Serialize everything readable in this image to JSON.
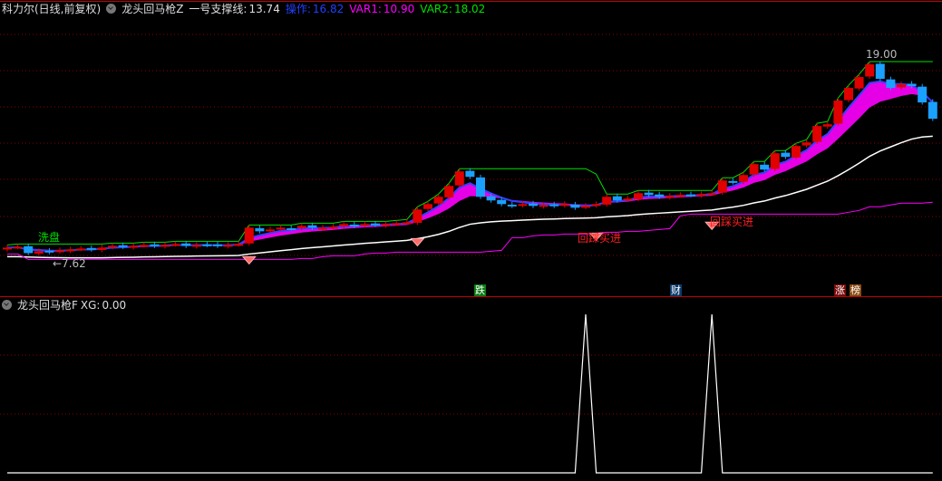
{
  "header": {
    "stock": "科力尔(日线,前复权)",
    "indicator": "龙头回马枪Z",
    "support_label": "一号支撑线:",
    "support_value": "13.74",
    "op_label": "操作:",
    "op_value": "16.82",
    "var1_label": "VAR1:",
    "var1_value": "10.90",
    "var2_label": "VAR2:",
    "var2_value": "18.02"
  },
  "sub_header": {
    "indicator": "龙头回马枪F",
    "xg_label": "XG:",
    "xg_value": "0.00"
  },
  "annotations": {
    "wash": "洗盘",
    "low": "←7.62",
    "high": "19.00",
    "buy1": "回踩买进",
    "buy2": "回踩买进"
  },
  "tags": [
    {
      "text": "跌",
      "color": "#0a7a14"
    },
    {
      "text": "财",
      "color": "#0b3a6a"
    },
    {
      "text": "涨",
      "color": "#7a0a0a"
    },
    {
      "text": "榜",
      "color": "#8a4a10"
    }
  ],
  "colors": {
    "up": "#e00000",
    "down": "#1aa0ff",
    "green": "#00e000",
    "magenta": "#ff00ff",
    "grid": "#8a0000"
  },
  "chart_data": {
    "type": "candlestick",
    "price_range": [
      7.62,
      19.0
    ],
    "closes": [
      8.2,
      8.25,
      7.9,
      8.0,
      7.95,
      8.05,
      8.1,
      8.15,
      8.1,
      8.2,
      8.3,
      8.25,
      8.3,
      8.35,
      8.3,
      8.35,
      8.4,
      8.3,
      8.35,
      8.35,
      8.3,
      8.35,
      8.4,
      9.3,
      9.1,
      9.2,
      9.3,
      9.25,
      9.4,
      9.3,
      9.3,
      9.35,
      9.5,
      9.4,
      9.5,
      9.45,
      9.5,
      9.55,
      9.6,
      10.3,
      10.6,
      11.0,
      11.6,
      12.4,
      12.1,
      11.0,
      10.8,
      10.6,
      10.5,
      10.6,
      10.5,
      10.55,
      10.5,
      10.6,
      10.4,
      10.5,
      10.6,
      11.0,
      10.8,
      10.9,
      11.2,
      11.1,
      11.0,
      11.05,
      11.1,
      11.1,
      11.15,
      11.2,
      11.9,
      11.8,
      12.2,
      12.8,
      12.5,
      13.4,
      13.2,
      13.8,
      14.0,
      14.9,
      15.0,
      16.3,
      17.0,
      17.6,
      18.3,
      17.5,
      17.0,
      17.2,
      17.1,
      16.2,
      15.3
    ],
    "buy_signal_indices": [
      23,
      39,
      56,
      67
    ],
    "xg": {
      "spike_indices": [
        55,
        67
      ],
      "range": [
        0,
        1
      ]
    }
  }
}
